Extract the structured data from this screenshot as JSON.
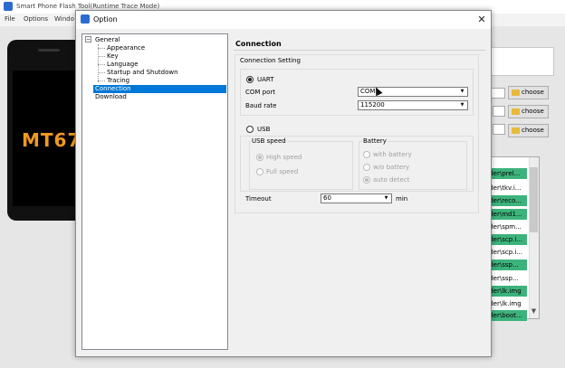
{
  "background_app": {
    "title": "Smart Phone Flash Tool(Runtime Trace Mode)",
    "menu": [
      "File",
      "Options",
      "Windo"
    ],
    "phone_text": "MT67",
    "choose_buttons": [
      "choose",
      "choose",
      "choose"
    ],
    "list_rows": [
      "older\\prel...",
      "older\\tkv.i...",
      "older\\reco...",
      "older\\md1...",
      "older\\spm...",
      "older\\scp.i...",
      "older\\scp.i...",
      "older\\ssp...",
      "older\\ssp...",
      "older\\lk.img",
      "older\\lk.img",
      "older\\boot..."
    ]
  },
  "dialog": {
    "title": "Option",
    "close_label": "✕",
    "tree": {
      "root": "General",
      "children": [
        "Appearance",
        "Key",
        "Language",
        "Startup and Shutdown",
        "Tracing"
      ],
      "items": [
        "Connection",
        "Download"
      ],
      "selected": "Connection",
      "toggle": "−"
    },
    "section_title": "Connection",
    "group_label": "Connection Setting",
    "uart": {
      "label": "UART",
      "selected": true,
      "com_port_label": "COM port",
      "com_port_value": "COM1",
      "baud_rate_label": "Baud rate",
      "baud_rate_value": "115200"
    },
    "usb": {
      "label": "USB",
      "selected": false,
      "speed_label": "USB speed",
      "speed_options": [
        "High speed",
        "Full speed"
      ],
      "speed_selected": "High speed",
      "battery_label": "Battery",
      "battery_options": [
        "with battery",
        "w/o battery",
        "auto detect"
      ],
      "battery_selected": "auto detect"
    },
    "timeout_label": "Timeout",
    "timeout_value": "60",
    "timeout_unit": "min"
  },
  "colors": {
    "selection": "#0078d7",
    "list_highlight": "#3db37c",
    "phone_text": "#f19a1e"
  },
  "icons": [
    "app-icon",
    "close-icon",
    "folder-icon",
    "dropdown-arrow-icon",
    "spin-arrow-icon",
    "mouse-cursor-icon"
  ]
}
